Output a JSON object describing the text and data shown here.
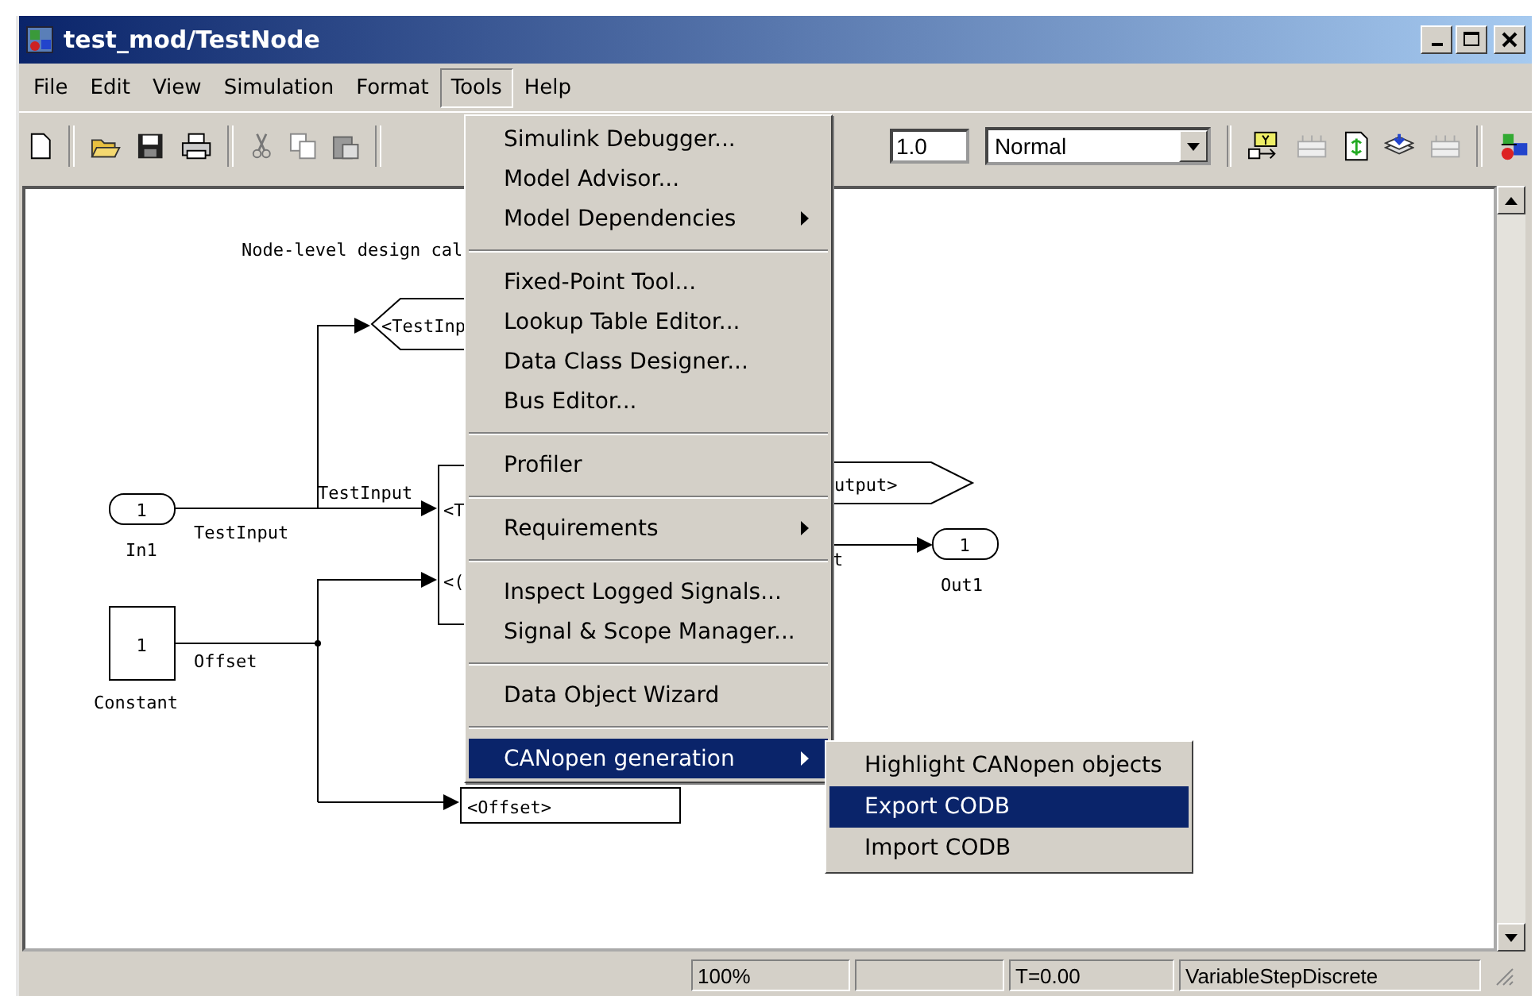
{
  "window": {
    "title": "test_mod/TestNode"
  },
  "menu_bar": [
    {
      "label": "File",
      "selected": false
    },
    {
      "label": "Edit",
      "selected": false
    },
    {
      "label": "View",
      "selected": false
    },
    {
      "label": "Simulation",
      "selected": false
    },
    {
      "label": "Format",
      "selected": false
    },
    {
      "label": "Tools",
      "selected": true
    },
    {
      "label": "Help",
      "selected": false
    }
  ],
  "toolbar": {
    "stop_time": "1.0",
    "mode": "Normal"
  },
  "diagram": {
    "annotation": "Node-level design cal",
    "goto_testinput": "<TestInp",
    "in1": {
      "number": "1",
      "name": "In1"
    },
    "signal_in": "TestInput",
    "signal_branch": "TestInput",
    "constant": {
      "value": "1",
      "name": "Constant"
    },
    "signal_offset": "Offset",
    "bus_inputs": [
      "<T",
      "<("
    ],
    "goto_output": "utput>",
    "fragment": "t",
    "out1": {
      "number": "1",
      "name": "Out1"
    },
    "offset_selector": "<Offset>"
  },
  "tools_menu": [
    [
      {
        "label": "Simulink Debugger...",
        "submenu": false,
        "selected": false
      },
      {
        "label": "Model Advisor...",
        "submenu": false,
        "selected": false
      },
      {
        "label": "Model Dependencies",
        "submenu": true,
        "selected": false
      }
    ],
    [
      {
        "label": "Fixed-Point Tool...",
        "submenu": false,
        "selected": false
      },
      {
        "label": "Lookup Table Editor...",
        "submenu": false,
        "selected": false
      },
      {
        "label": "Data Class Designer...",
        "submenu": false,
        "selected": false
      },
      {
        "label": "Bus Editor...",
        "submenu": false,
        "selected": false
      }
    ],
    [
      {
        "label": "Profiler",
        "submenu": false,
        "selected": false
      }
    ],
    [
      {
        "label": "Requirements",
        "submenu": true,
        "selected": false
      }
    ],
    [
      {
        "label": "Inspect Logged Signals...",
        "submenu": false,
        "selected": false
      },
      {
        "label": "Signal & Scope Manager...",
        "submenu": false,
        "selected": false
      }
    ],
    [
      {
        "label": "Data Object Wizard",
        "submenu": false,
        "selected": false
      }
    ],
    [
      {
        "label": "CANopen generation",
        "submenu": true,
        "selected": true
      }
    ]
  ],
  "submenu": [
    {
      "label": "Highlight CANopen objects",
      "selected": false
    },
    {
      "label": "Export CODB",
      "selected": true
    },
    {
      "label": "Import CODB",
      "selected": false
    }
  ],
  "status_bar": [
    "100%",
    "T=0.00",
    "VariableStepDiscrete"
  ]
}
